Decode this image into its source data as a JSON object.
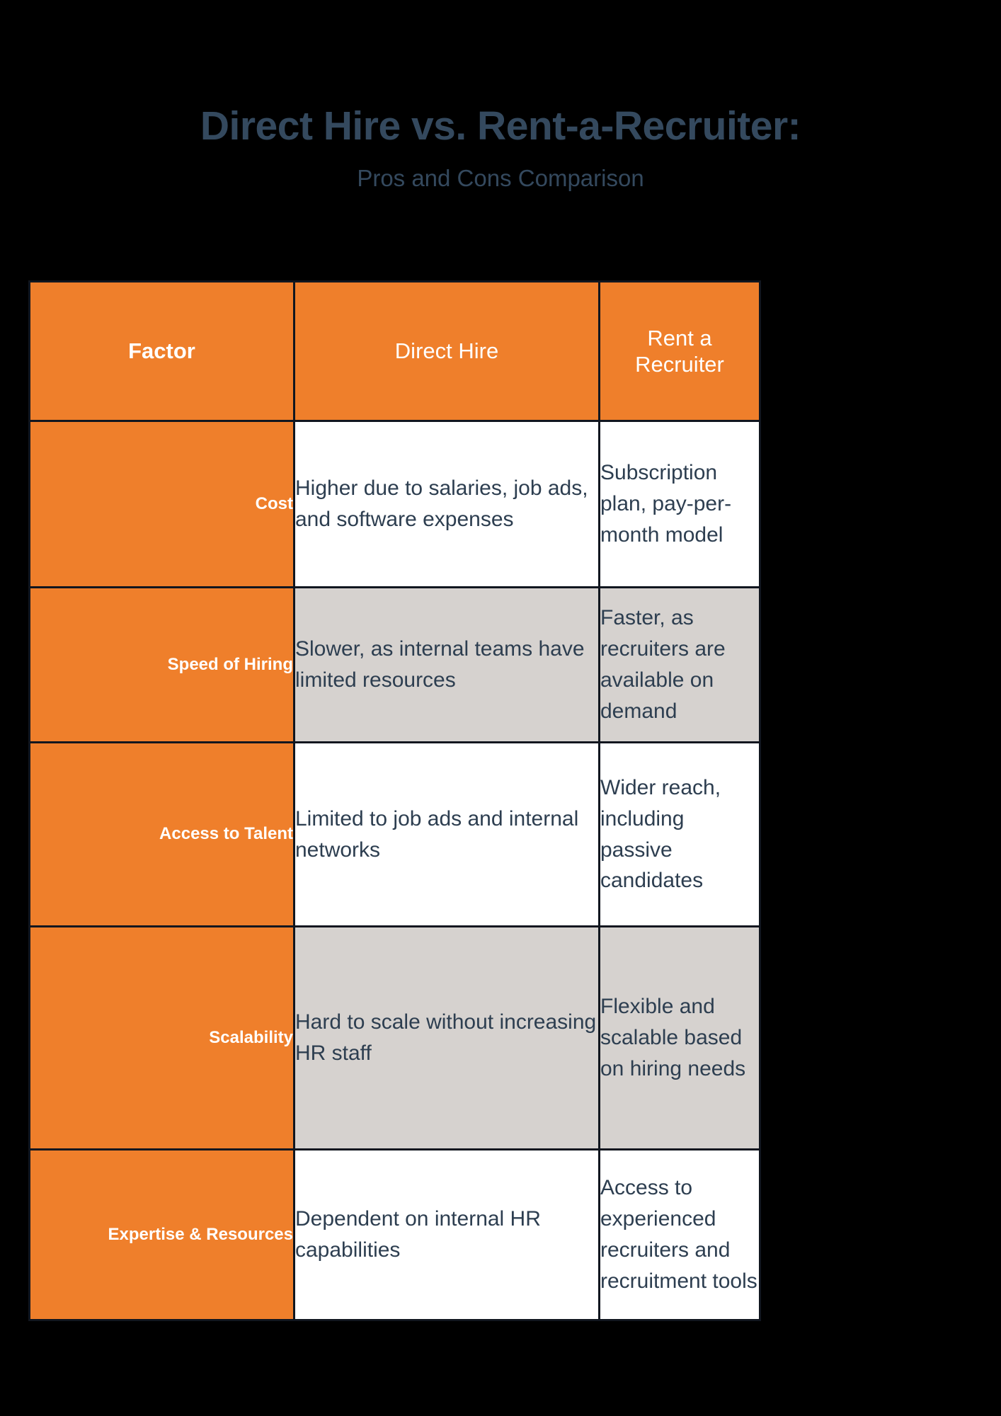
{
  "page": {
    "background_color": "#000000",
    "accent_color": "#ef7f2b",
    "text_color": "#2d3e50",
    "alt_row_color": "#d6d2cf",
    "border_color": "#11161f"
  },
  "heading": {
    "title": "Direct Hire vs. Rent-a-Recruiter:",
    "subtitle": "Pros and Cons Comparison"
  },
  "table": {
    "headers": {
      "factor": "Factor",
      "direct_hire": "Direct Hire",
      "rent_a_recruiter": "Rent a Recruiter"
    },
    "rows": [
      {
        "factor": "Cost",
        "direct_hire": "Higher due to salaries, job ads, and software expenses",
        "rent_a_recruiter": "Subscription plan, pay-per-month model",
        "shade": "white"
      },
      {
        "factor": "Speed of Hiring",
        "direct_hire": "Slower, as internal teams have limited resources",
        "rent_a_recruiter": "Faster, as recruiters are available on demand",
        "shade": "gray"
      },
      {
        "factor": "Access to Talent",
        "direct_hire": "Limited to job ads and internal networks",
        "rent_a_recruiter": "Wider reach, including passive candidates",
        "shade": "white"
      },
      {
        "factor": "Scalability",
        "direct_hire": "Hard to scale without increasing HR staff",
        "rent_a_recruiter": "Flexible and scalable based on hiring needs",
        "shade": "gray"
      },
      {
        "factor": "Expertise & Resources",
        "direct_hire": "Dependent on internal HR capabilities",
        "rent_a_recruiter": "Access to experienced recruiters and recruitment tools",
        "shade": "white"
      }
    ]
  }
}
